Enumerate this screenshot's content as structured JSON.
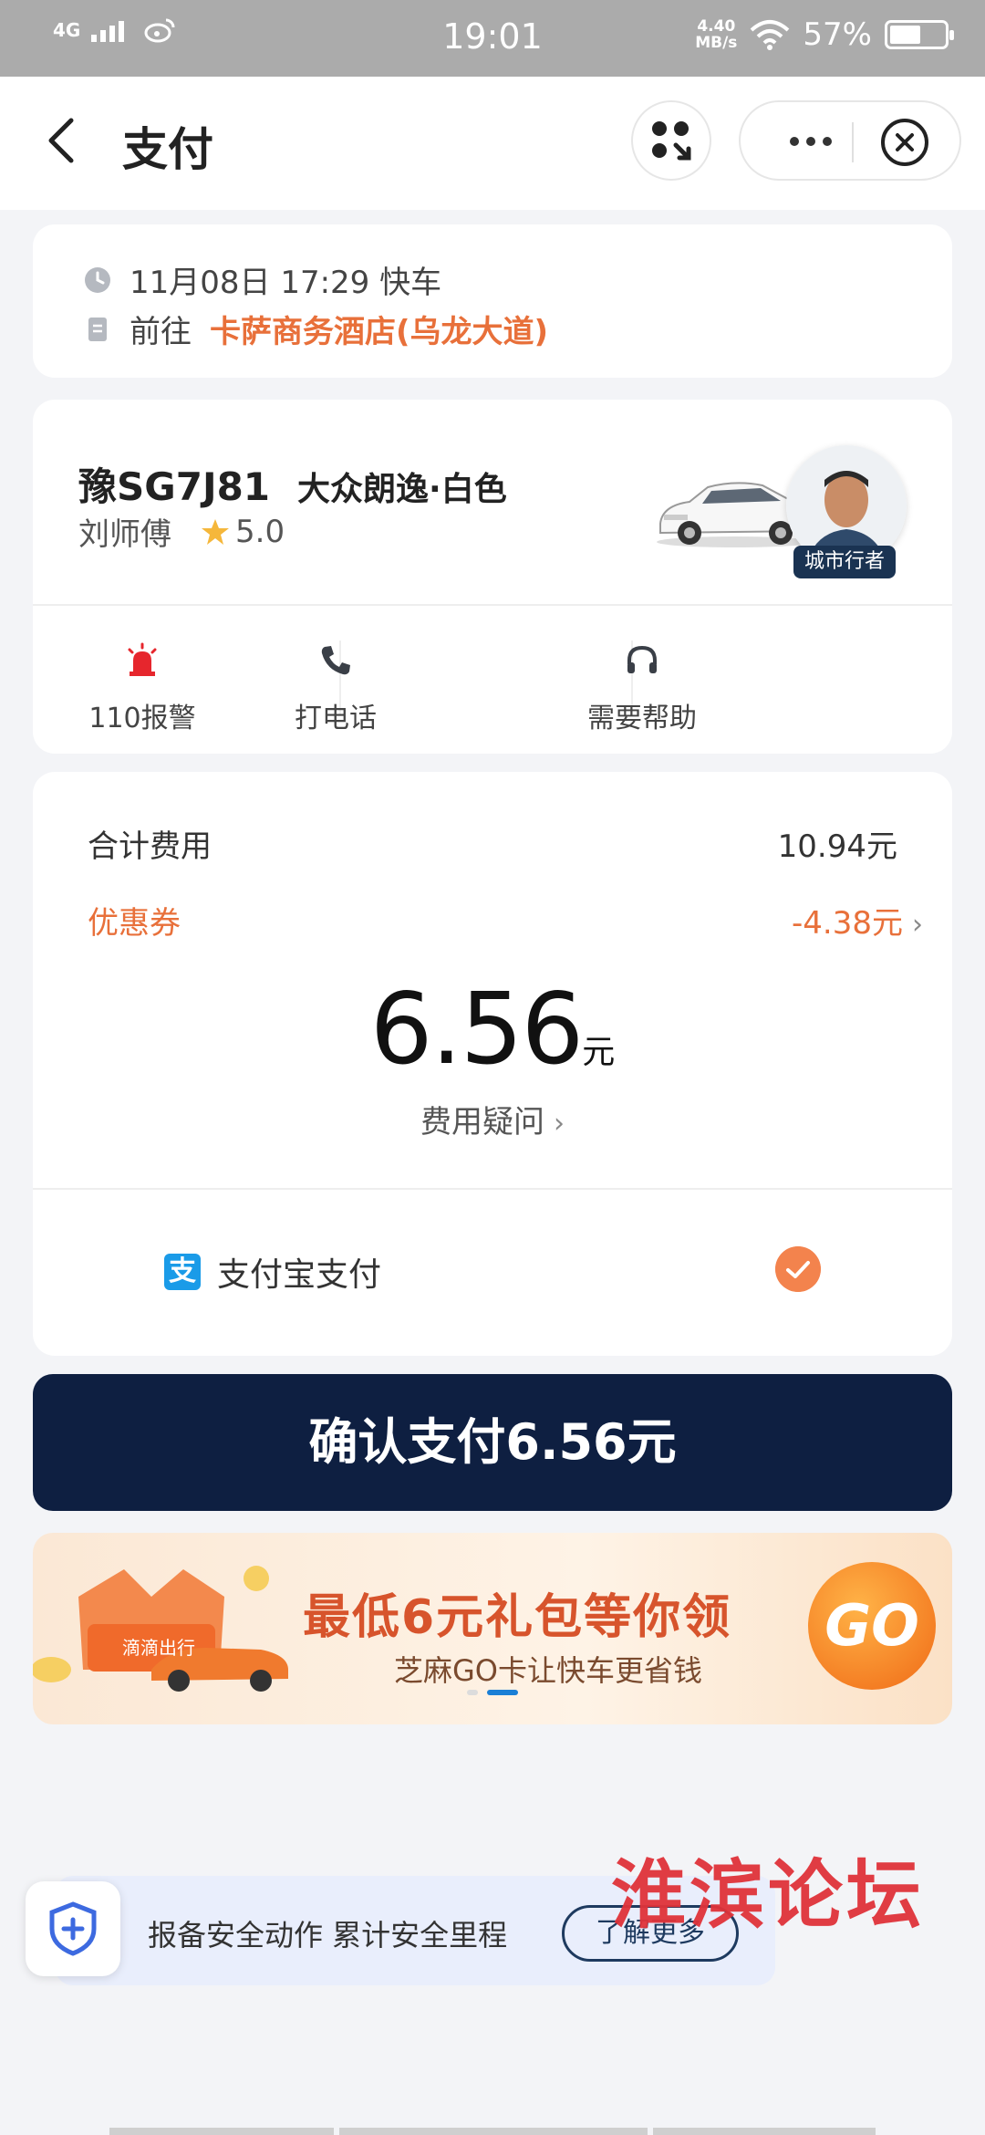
{
  "status_bar": {
    "network": "4G",
    "time": "19:01",
    "speed_value": "4.40",
    "speed_unit": "MB/s",
    "battery": "57%",
    "battery_level": 0.57
  },
  "nav": {
    "title": "支付"
  },
  "trip": {
    "datetime": "11月08日 17:29 快车",
    "dest_prefix": "前往",
    "destination": "卡萨商务酒店(乌龙大道)"
  },
  "driver": {
    "plate": "豫SG7J81",
    "car": "大众朗逸·白色",
    "name": "刘师傅",
    "rating": "5.0",
    "badge": "城市行者",
    "actions": [
      {
        "label": "110报警",
        "icon": "alarm-icon"
      },
      {
        "label": "打电话",
        "icon": "phone-icon"
      },
      {
        "label": "需要帮助",
        "icon": "headset-icon"
      }
    ]
  },
  "fare": {
    "total_label": "合计费用",
    "total_value": "10.94元",
    "coupon_label": "优惠券",
    "coupon_value": "-4.38元",
    "amount": "6.56",
    "amount_unit": "元",
    "query": "费用疑问",
    "pay_method": "支付宝支付",
    "pay_icon_char": "支"
  },
  "confirm": {
    "label": "确认支付6.56元"
  },
  "banner": {
    "title": "最低6元礼包等你领",
    "subtitle": "芝麻GO卡让快车更省钱",
    "go": "GO",
    "brand": "滴滴出行"
  },
  "safety": {
    "text": "报备安全动作 累计安全里程",
    "button": "了解更多"
  },
  "watermark": "淮滨论坛",
  "colors": {
    "accent": "#e8703a",
    "primary_dark": "#0e1f41",
    "alipay": "#1a9be8"
  }
}
